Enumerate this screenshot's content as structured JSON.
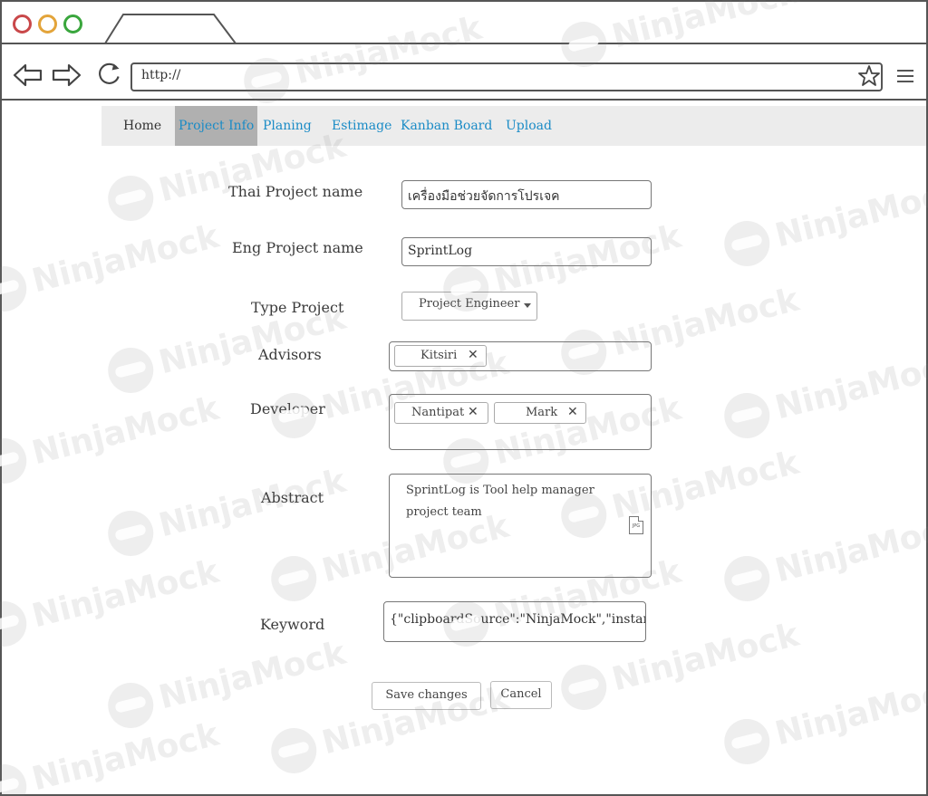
{
  "browser": {
    "url": "http://"
  },
  "nav": {
    "items": [
      {
        "label": "Home"
      },
      {
        "label": "Project Info"
      },
      {
        "label": "Planing"
      },
      {
        "label": "Estimage"
      },
      {
        "label": "Kanban Board"
      },
      {
        "label": "Upload"
      }
    ],
    "active": "Project Info"
  },
  "form": {
    "thai_name_label": "Thai Project name",
    "thai_name_value": "เครื่องมือช่วยจัดการโปรเจค",
    "eng_name_label": "Eng Project name",
    "eng_name_value": "SprintLog",
    "type_label": "Type Project",
    "type_value": "Project  Engineer",
    "advisors_label": "Advisors",
    "advisors": [
      "Kitsiri"
    ],
    "developer_label": "Developer",
    "developers": [
      "Nantipat",
      "Mark"
    ],
    "abstract_label": "Abstract",
    "abstract_lines": [
      "SprintLog is Tool help manager",
      "project team"
    ],
    "abstract_file_icon_text": "JPG",
    "keyword_label": "Keyword",
    "keyword_value": "{\"clipboardSource\":\"NinjaMock\",\"instanceId"
  },
  "actions": {
    "save_label": "Save changes",
    "cancel_label": "Cancel"
  },
  "watermark": {
    "text": "NinjaMock"
  },
  "colors": {
    "link": "#1a8bc6",
    "active_tab_bg": "#b0b0b0",
    "nav_bg": "#ececec"
  }
}
